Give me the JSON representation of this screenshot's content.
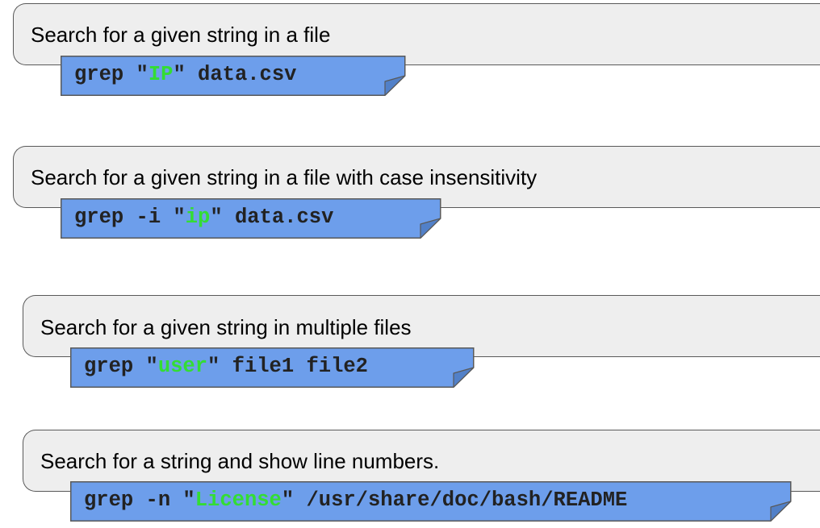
{
  "colors": {
    "card_background": "#eeeeee",
    "card_border": "#595959",
    "command_background": "#6d9eeb",
    "command_text": "#222222",
    "search_term": "#33dd33"
  },
  "examples": [
    {
      "description": "Search for a given string in a file",
      "command": {
        "prefix": "grep \"",
        "term": "IP",
        "suffix": "\" data.csv"
      }
    },
    {
      "description": "Search for a given string in a file with case insensitivity",
      "command": {
        "prefix": "grep -i \"",
        "term": "ip",
        "suffix": "\" data.csv"
      }
    },
    {
      "description": "Search for a given string in multiple files",
      "command": {
        "prefix": "grep \"",
        "term": "user",
        "suffix": "\" file1 file2"
      }
    },
    {
      "description": "Search for a string and show line numbers.",
      "command": {
        "prefix": "grep -n \"",
        "term": "License",
        "suffix": "\" /usr/share/doc/bash/README"
      }
    }
  ]
}
